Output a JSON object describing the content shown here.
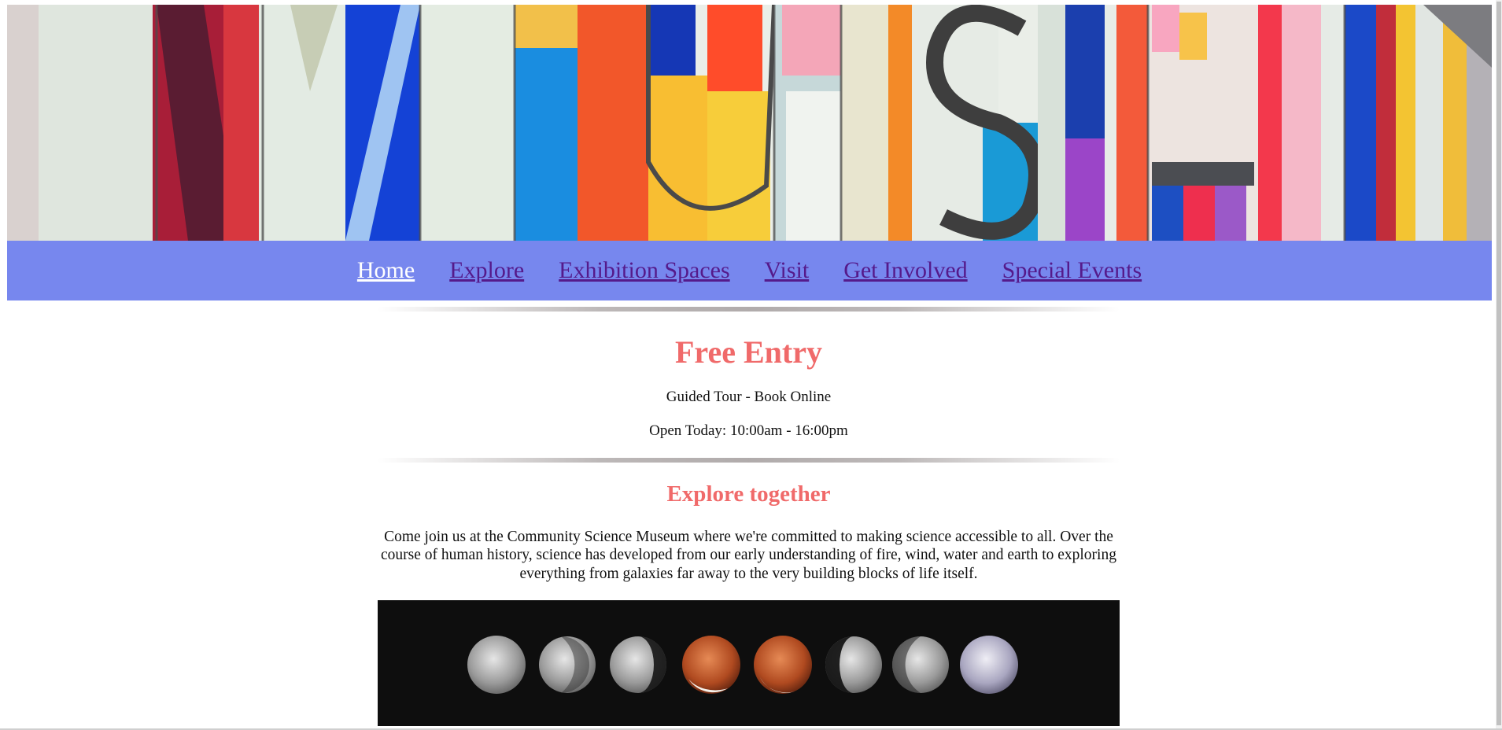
{
  "hero": {
    "image": "colorful-museum-facade-image"
  },
  "nav": {
    "items": [
      {
        "label": "Home",
        "active": true
      },
      {
        "label": "Explore"
      },
      {
        "label": "Exhibition Spaces"
      },
      {
        "label": "Visit"
      },
      {
        "label": "Get Involved"
      },
      {
        "label": "Special Events"
      }
    ]
  },
  "promo": {
    "title": "Free Entry",
    "tour": "Guided Tour - Book Online",
    "hours": "Open Today: 10:00am - 16:00pm"
  },
  "about": {
    "heading": "Explore together",
    "text": "Come join us at the Community Science Museum where we're committed to making science accessible to all. Over the course of human history, science has developed from our early understanding of fire, wind, water and earth to exploring everything from galaxies far away to the very building blocks of life itself."
  },
  "moon_image": {
    "image": "lunar-eclipse-phases-image"
  },
  "colors": {
    "nav_bg": "#7787ee",
    "link": "#551a8b",
    "active_link": "#ffffff",
    "heading": "#f06a6a"
  }
}
